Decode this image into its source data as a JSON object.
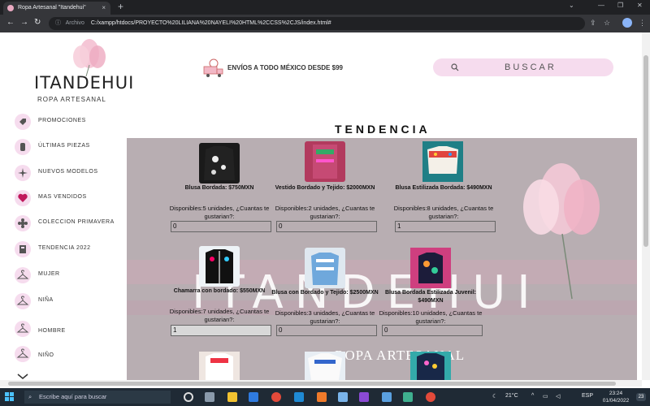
{
  "browser": {
    "tab_title": "Ropa Artesanal \"Itandehui\"",
    "tab_close": "×",
    "new_tab": "+",
    "address_protocol": "Archivo",
    "address_url": "C:/xampp/htdocs/PROYECTO%20LILIANA%20NAYELI%20HTML%2CCSS%2CJS/index.html#"
  },
  "header": {
    "logo_title": "ITANDEHUI",
    "logo_subtitle": "ROPA ARTESANAL",
    "shipping_text": "ENVÍOS A TODO MÉXICO DESDE $99",
    "search_label": "BUSCAR"
  },
  "sidebar": {
    "items": [
      {
        "label": "PROMOCIONES",
        "icon": "tag-icon"
      },
      {
        "label": "ÚLTIMAS PIEZAS",
        "icon": "jar-icon"
      },
      {
        "label": "NUEVOS MODELOS",
        "icon": "sparkle-icon"
      },
      {
        "label": "MAS VENDIDOS",
        "icon": "heart-icon"
      },
      {
        "label": "COLECCION PRIMAVERA",
        "icon": "flower-icon"
      },
      {
        "label": "TENDENCIA 2022",
        "icon": "trend-icon"
      },
      {
        "label": "MUJER",
        "icon": "hanger-icon"
      },
      {
        "label": "NIÑA",
        "icon": "hanger-icon"
      },
      {
        "label": "HOMBRE",
        "icon": "hanger-icon"
      },
      {
        "label": "NIÑO",
        "icon": "hanger-icon"
      }
    ]
  },
  "main": {
    "section_title": "TENDENCIA",
    "watermark_title": "ITANDEHUI",
    "watermark_subtitle": "ROPA ARTESANAL",
    "products": [
      {
        "name": "Blusa Bordada: $750MXN",
        "stock": "Disponibles:5 unidades, ¿Cuantas te gustarian?:",
        "qty": "0"
      },
      {
        "name": "Vestido Bordado y Tejido: $2000MXN",
        "stock": "Disponibles:2 unidades, ¿Cuantas te gustarian?:",
        "qty": "0"
      },
      {
        "name": "Blusa Estilizada Bordada: $490MXN",
        "stock": "Disponibles:8 unidades, ¿Cuantas te gustarian?:",
        "qty": "1"
      },
      {
        "name": "Chamarra con bordado: $550MXN",
        "stock": "Disponibles:7 unidades, ¿Cuantas te gustarian?:",
        "qty": "1"
      },
      {
        "name": "Blusa con Bordado y Tejido: $2500MXN",
        "stock": "Disponibles:3 unidades, ¿Cuantas te gustarian?:",
        "qty": "0"
      },
      {
        "name": "Blusa Bordada Estilizada Juvenil: $490MXN",
        "stock": "Disponibles:10 unidades, ¿Cuantas te gustarian?:",
        "qty": "0"
      }
    ]
  },
  "taskbar": {
    "search_placeholder": "Escribe aquí para buscar",
    "temperature": "21°C",
    "language": "ESP",
    "time": "23:24",
    "date": "01/04/2022",
    "notifications": "23"
  },
  "colors": {
    "accent_pink": "#f6dcee",
    "main_panel": "#b8aeb2",
    "browser_dark": "#35363a"
  }
}
